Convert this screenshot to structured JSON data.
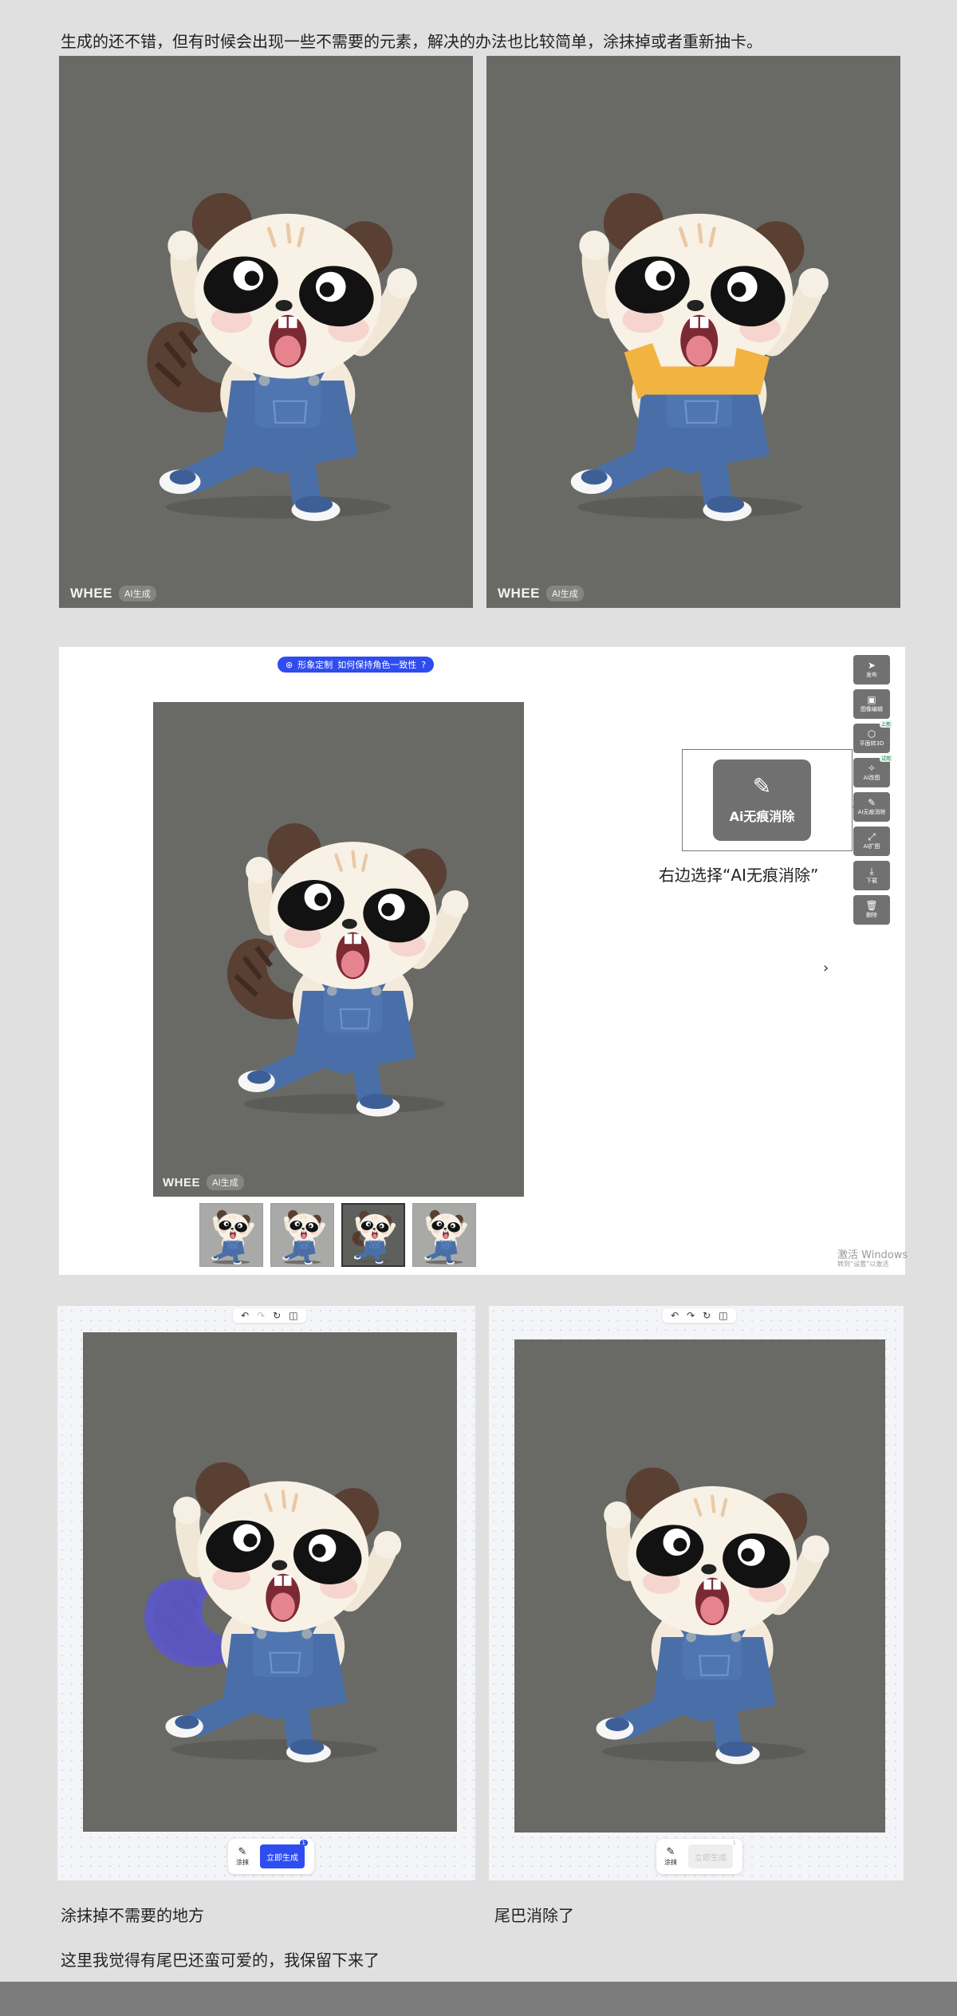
{
  "captions": {
    "intro": "生成的还不错，但有时候会出现一些不需要的元素，解决的办法也比较简单，涂抹掉或者重新抽卡。",
    "pick_tool": "右边选择“AI无痕消除”",
    "smear": "涂抹掉不需要的地方",
    "tail_removed": "尾巴消除了",
    "keep_tail": "这里我觉得有尾巴还蛮可爱的，我保留下来了"
  },
  "watermark": {
    "logo": "WHEE",
    "badge": "AI生成"
  },
  "editor": {
    "top_pill_icon": "⊛",
    "top_pill_label": "形象定制",
    "top_pill_link": "如何保持角色一致性",
    "top_pill_help_icon": "?",
    "tools": [
      {
        "icon": "send-icon",
        "glyph": "➤",
        "label": "发布",
        "tag": ""
      },
      {
        "icon": "image-edit-icon",
        "glyph": "▣",
        "label": "图像编辑",
        "tag": ""
      },
      {
        "icon": "cube-icon",
        "glyph": "⬡",
        "label": "平面转3D",
        "tag": "上新"
      },
      {
        "icon": "magic-wand-icon",
        "glyph": "✧",
        "label": "AI改图",
        "tag": "试用"
      },
      {
        "icon": "eraser-icon",
        "glyph": "✎",
        "label": "AI无痕消除",
        "tag": ""
      },
      {
        "icon": "expand-icon",
        "glyph": "⤢",
        "label": "AI扩图",
        "tag": ""
      },
      {
        "icon": "download-icon",
        "glyph": "⤓",
        "label": "下载",
        "tag": ""
      },
      {
        "icon": "trash-icon",
        "glyph": "🗑",
        "label": "删除",
        "tag": ""
      }
    ],
    "highlight_label": "Ai无痕消除",
    "next_arrow": "›",
    "activation_line1": "激活 Windows",
    "activation_line2": "转到“设置”以激活"
  },
  "erase_toolbar": {
    "left_glyphs": [
      "↶",
      "↷",
      "↻",
      "◫"
    ],
    "right_glyphs": [
      "↶",
      "↷",
      "↻",
      "◫"
    ],
    "brush_label": "涂抹",
    "generate_label": "立即生成",
    "cost_badge": "1"
  },
  "colors": {
    "page_bg": "#e0e0e0",
    "image_bg": "#696a66",
    "accent_blue": "#2e4cf0",
    "tool_gray": "#717171",
    "overalls": "#4a6fa8",
    "smear_purple": "#5b58c9",
    "shirt_yellow": "#f2b440"
  }
}
